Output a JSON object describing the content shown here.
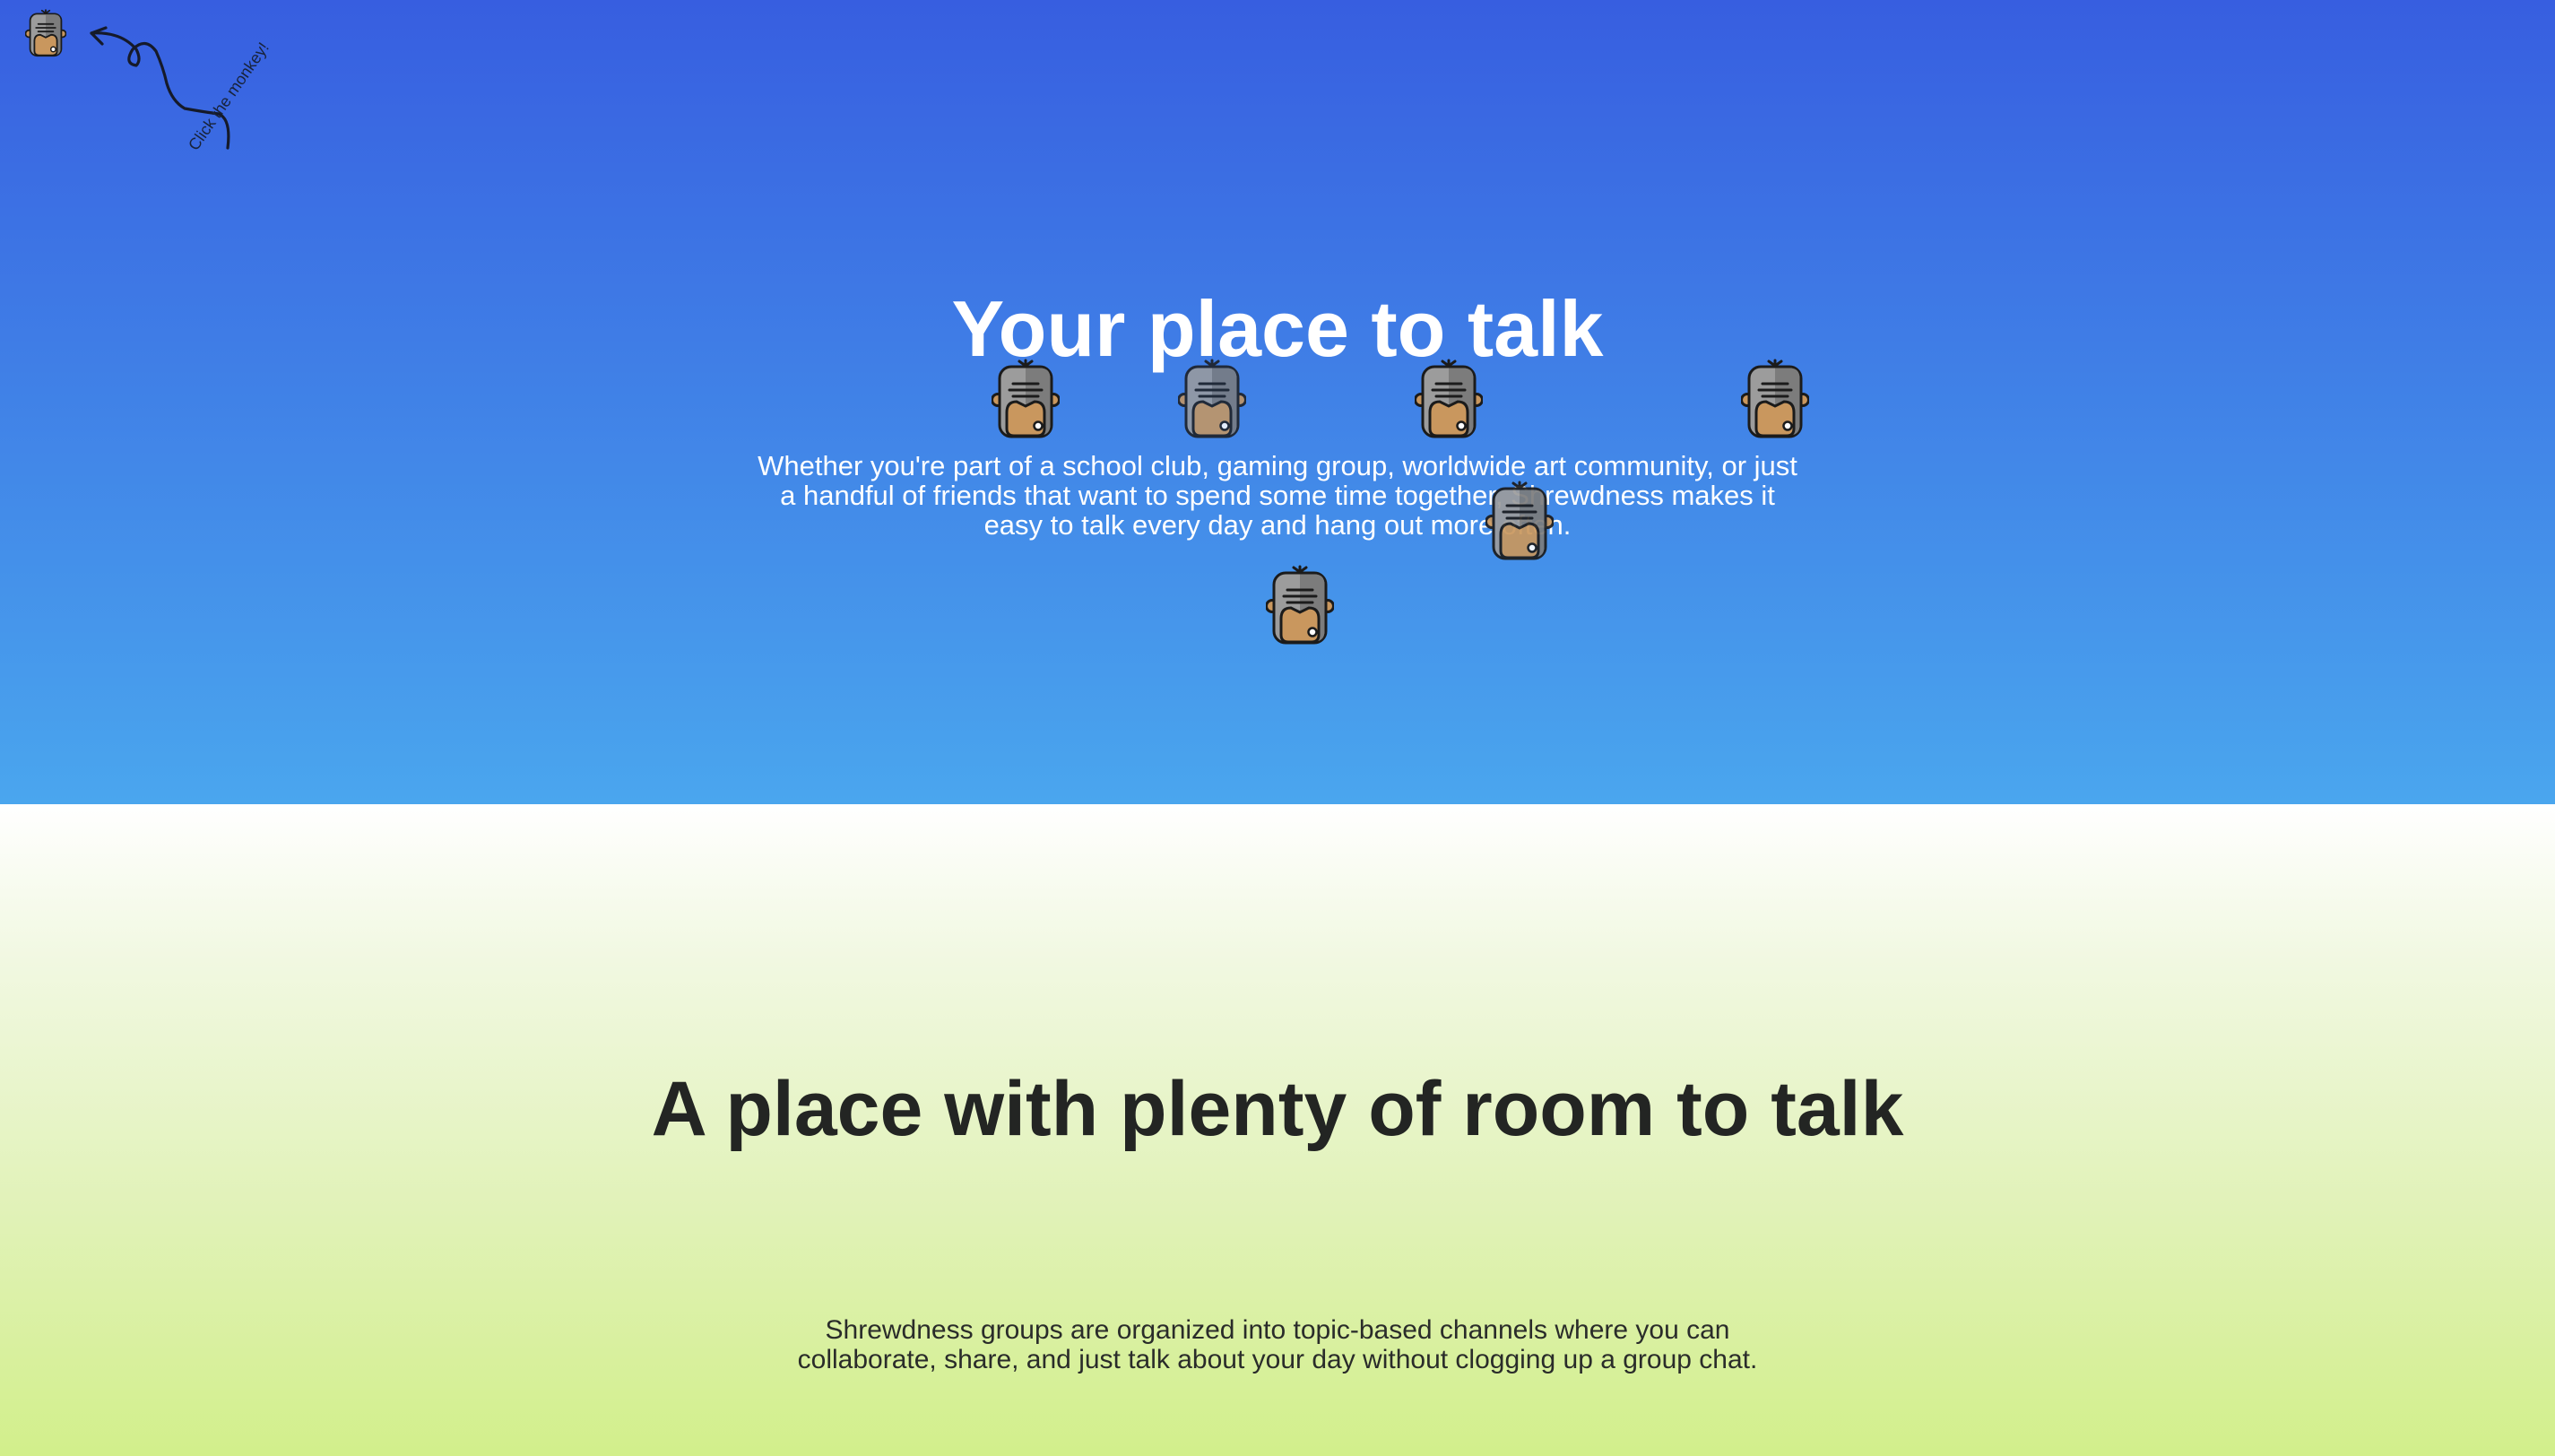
{
  "hero": {
    "title": "Your place to talk",
    "text": "Whether you're part of a school club, gaming group, worldwide art community, or just a handful of friends that want to spend some time together, Shrewdness makes it easy to talk every day and hang out more often.",
    "hint": "Click the monkey!",
    "gradient": [
      "#375ee0",
      "#4aa6ee"
    ],
    "monkey_icon": "monkey-robot-icon"
  },
  "section2": {
    "title": "A place with plenty of room to talk",
    "text": "Shrewdness groups are organized into topic-based channels where you can collaborate, share, and just talk about your day without clogging up a group chat.",
    "gradient": [
      "#ffffff",
      "#d2ef8b"
    ]
  }
}
